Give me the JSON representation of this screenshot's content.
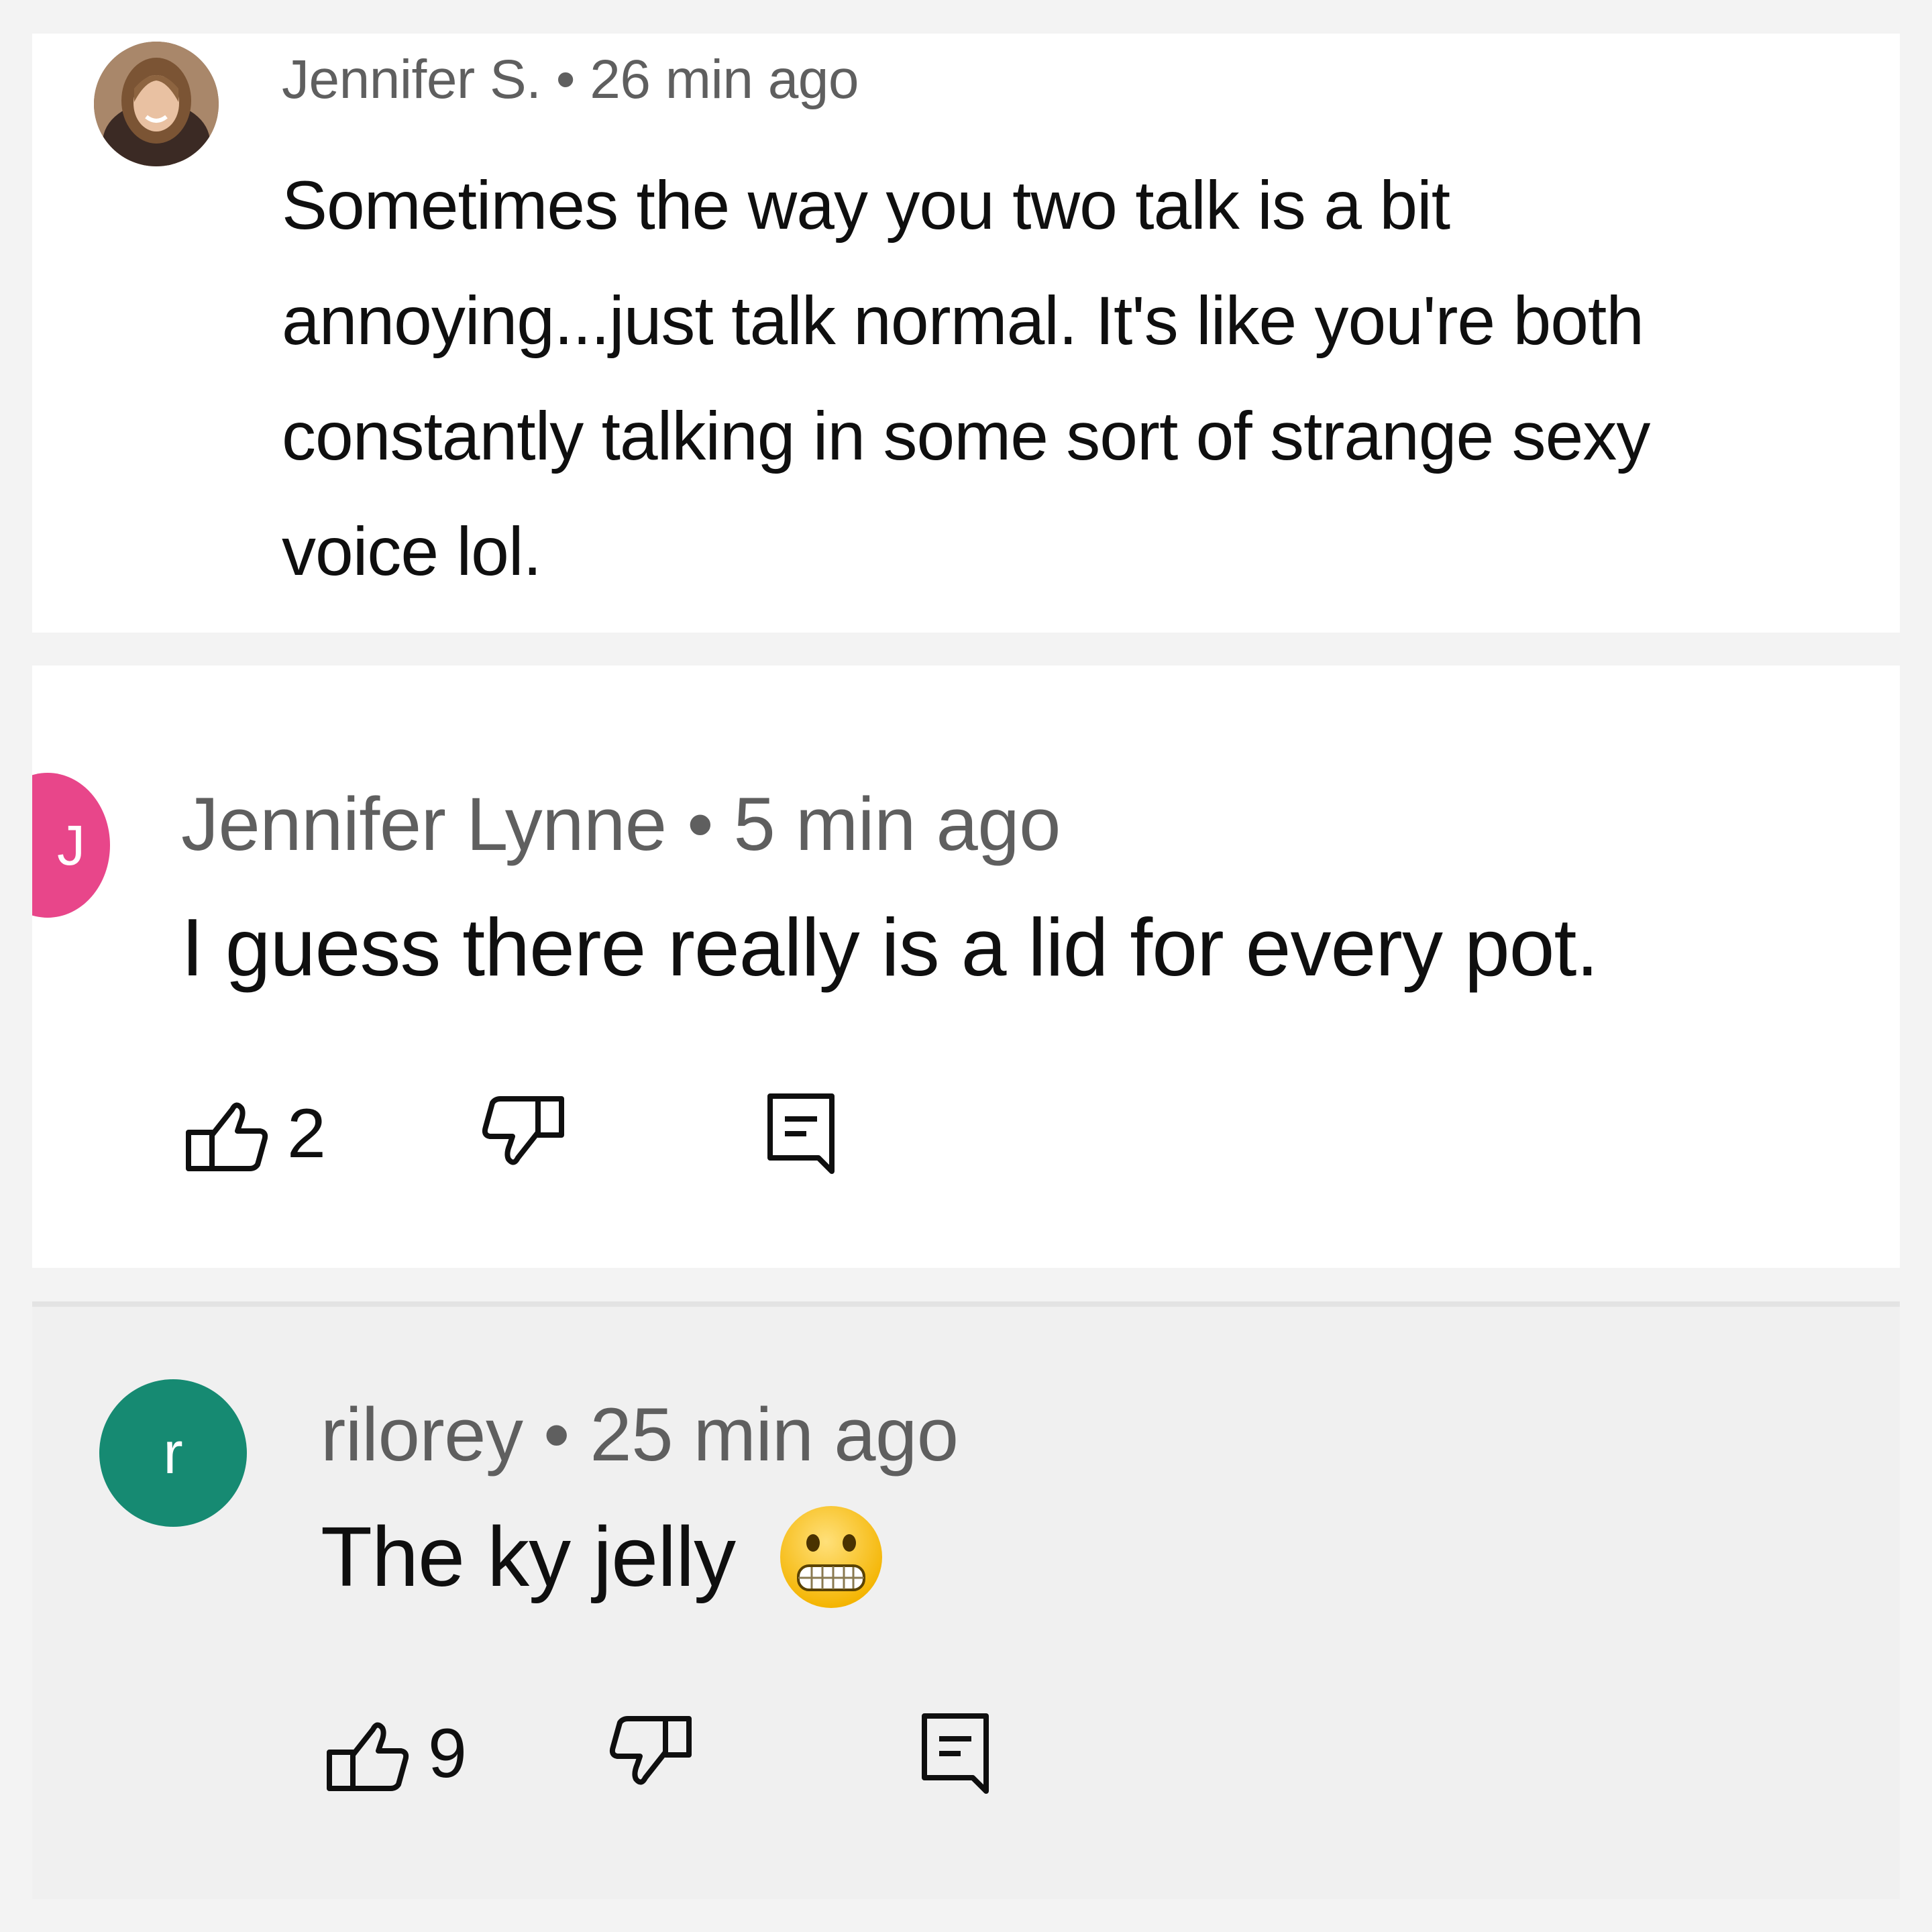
{
  "comments": [
    {
      "author": "Jennifer S.",
      "separator": "•",
      "time": "26 min ago",
      "text": "Sometimes the way you two talk is a bit annoying...just talk normal.  It's like you're both constantly talking in some sort of strange sexy voice lol.",
      "avatar": {
        "type": "photo",
        "color": "#8a6a50"
      }
    },
    {
      "author": "Jennifer Lynne",
      "separator": "•",
      "time": "5 min ago",
      "text": "I guess there really is a lid for every pot.",
      "avatar": {
        "type": "letter",
        "letter": "J",
        "color": "#e8468a"
      },
      "likes": "2"
    },
    {
      "author": "rilorey",
      "separator": "•",
      "time": "25 min ago",
      "text": "The ky jelly",
      "emoji": "grimacing-face",
      "avatar": {
        "type": "letter",
        "letter": "r",
        "color": "#168a72"
      },
      "likes": "9"
    }
  ],
  "icons": {
    "like": "thumbs-up-icon",
    "dislike": "thumbs-down-icon",
    "reply": "reply-comment-icon"
  }
}
